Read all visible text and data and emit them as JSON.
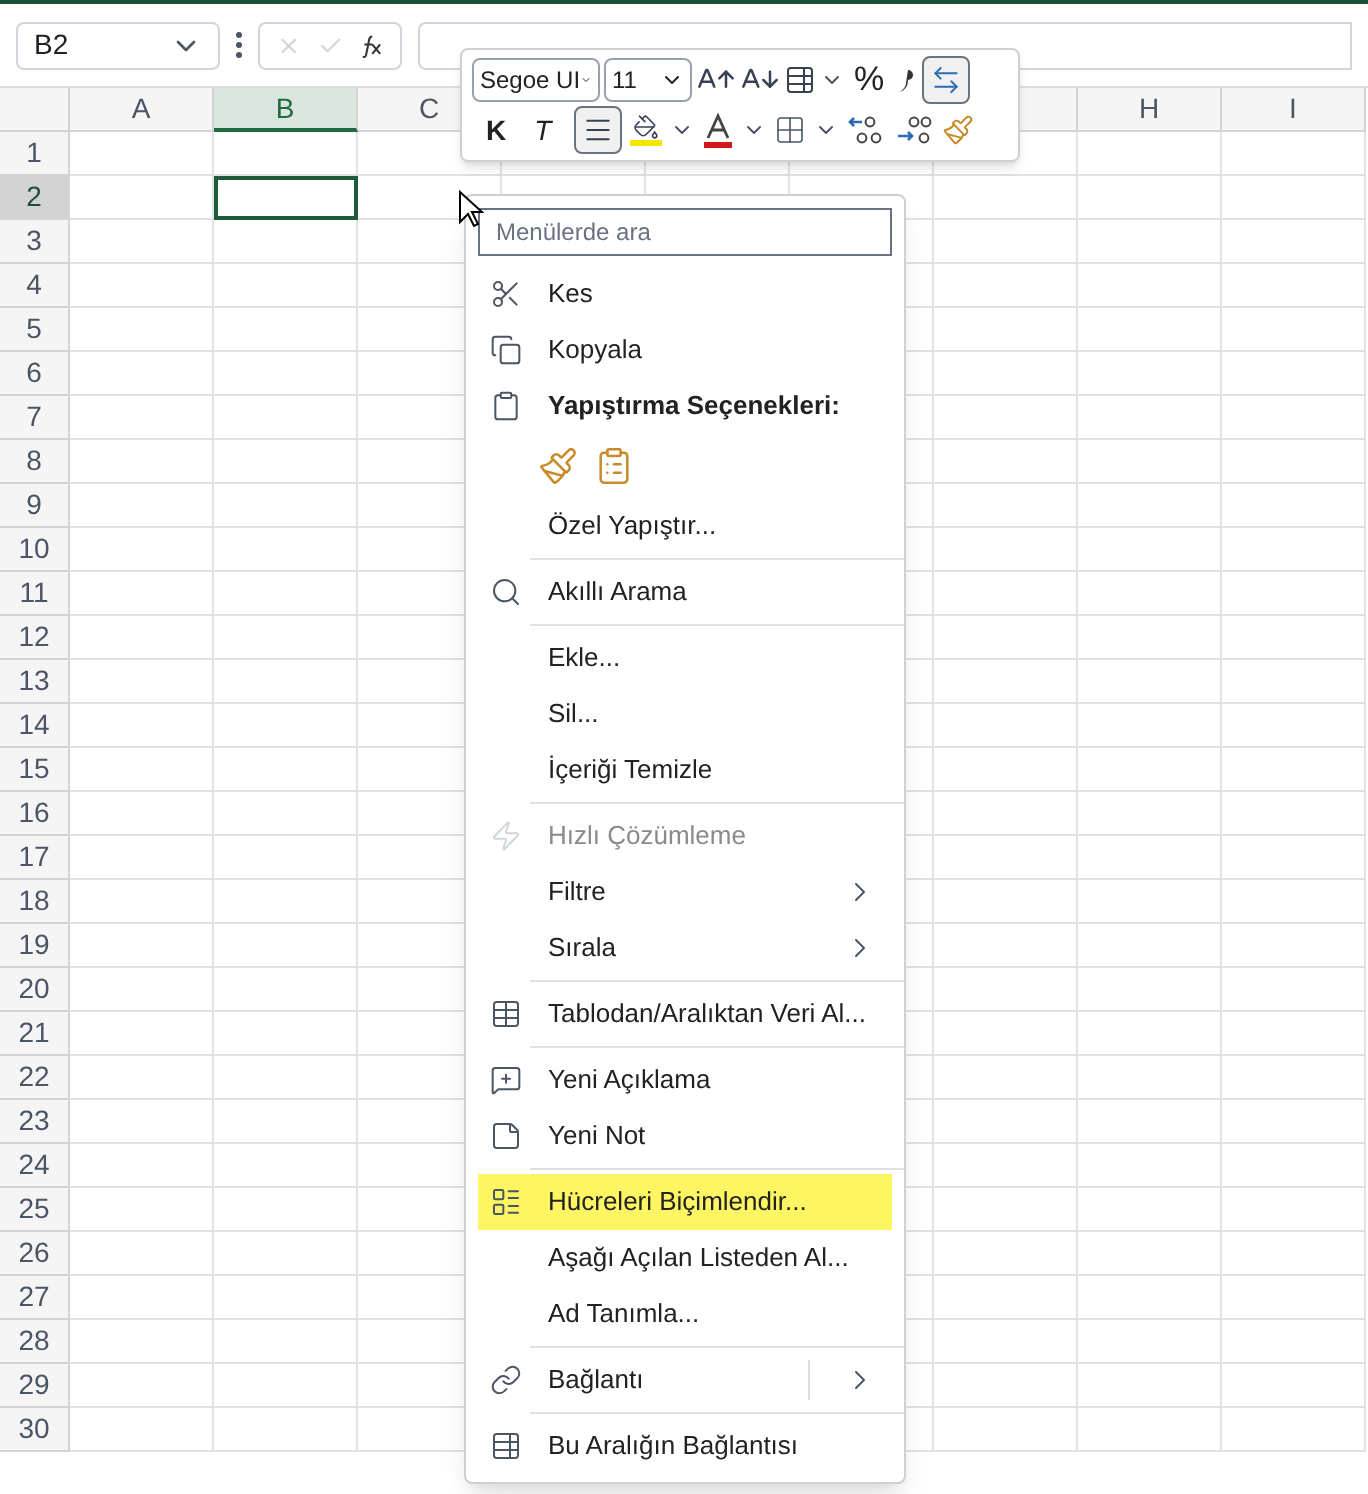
{
  "name_box": {
    "value": "B2"
  },
  "columns": [
    {
      "label": "A",
      "selected": false
    },
    {
      "label": "B",
      "selected": true
    },
    {
      "label": "C",
      "selected": false
    },
    {
      "label": "H",
      "selected": false
    },
    {
      "label": "I",
      "selected": false
    }
  ],
  "rows": [
    {
      "label": "1",
      "selected": false
    },
    {
      "label": "2",
      "selected": true
    },
    {
      "label": "3",
      "selected": false
    },
    {
      "label": "4",
      "selected": false
    },
    {
      "label": "5",
      "selected": false
    },
    {
      "label": "6",
      "selected": false
    },
    {
      "label": "7",
      "selected": false
    },
    {
      "label": "8",
      "selected": false
    },
    {
      "label": "9",
      "selected": false
    },
    {
      "label": "10",
      "selected": false
    },
    {
      "label": "11",
      "selected": false
    },
    {
      "label": "12",
      "selected": false
    },
    {
      "label": "13",
      "selected": false
    },
    {
      "label": "14",
      "selected": false
    },
    {
      "label": "15",
      "selected": false
    },
    {
      "label": "16",
      "selected": false
    },
    {
      "label": "17",
      "selected": false
    },
    {
      "label": "18",
      "selected": false
    },
    {
      "label": "19",
      "selected": false
    },
    {
      "label": "20",
      "selected": false
    },
    {
      "label": "21",
      "selected": false
    },
    {
      "label": "22",
      "selected": false
    },
    {
      "label": "23",
      "selected": false
    },
    {
      "label": "24",
      "selected": false
    },
    {
      "label": "25",
      "selected": false
    },
    {
      "label": "26",
      "selected": false
    },
    {
      "label": "27",
      "selected": false
    },
    {
      "label": "28",
      "selected": false
    },
    {
      "label": "29",
      "selected": false
    },
    {
      "label": "30",
      "selected": false
    }
  ],
  "mini_toolbar": {
    "font": "Segoe UI",
    "size": "11",
    "percent": "%",
    "bold": "K",
    "italic": "T",
    "center_selected": true,
    "wrap_selected": true
  },
  "context_menu": {
    "search_placeholder": "Menülerde ara",
    "items": [
      {
        "kind": "item",
        "label": "Kes",
        "disabled": false,
        "submenu": false,
        "highlighted": false
      },
      {
        "kind": "item",
        "label": "Kopyala",
        "disabled": false,
        "submenu": false,
        "highlighted": false
      },
      {
        "kind": "header",
        "label": "Yapıştırma Seçenekleri:"
      },
      {
        "kind": "paste"
      },
      {
        "kind": "item",
        "label": "Özel Yapıştır...",
        "disabled": false,
        "submenu": false,
        "highlighted": false
      },
      {
        "kind": "separator"
      },
      {
        "kind": "item",
        "label": "Akıllı Arama",
        "disabled": false,
        "submenu": false,
        "highlighted": false
      },
      {
        "kind": "separator"
      },
      {
        "kind": "item",
        "label": "Ekle...",
        "disabled": false,
        "submenu": false,
        "highlighted": false
      },
      {
        "kind": "item",
        "label": "Sil...",
        "disabled": false,
        "submenu": false,
        "highlighted": false
      },
      {
        "kind": "item",
        "label": "İçeriği Temizle",
        "disabled": false,
        "submenu": false,
        "highlighted": false
      },
      {
        "kind": "separator"
      },
      {
        "kind": "item",
        "label": "Hızlı Çözümleme",
        "disabled": true,
        "submenu": false,
        "highlighted": false
      },
      {
        "kind": "item",
        "label": "Filtre",
        "disabled": false,
        "submenu": true,
        "highlighted": false
      },
      {
        "kind": "item",
        "label": "Sırala",
        "disabled": false,
        "submenu": true,
        "highlighted": false
      },
      {
        "kind": "separator"
      },
      {
        "kind": "item",
        "label": "Tablodan/Aralıktan Veri Al...",
        "disabled": false,
        "submenu": false,
        "highlighted": false
      },
      {
        "kind": "separator"
      },
      {
        "kind": "item",
        "label": "Yeni Açıklama",
        "disabled": false,
        "submenu": false,
        "highlighted": false
      },
      {
        "kind": "item",
        "label": "Yeni Not",
        "disabled": false,
        "submenu": false,
        "highlighted": false
      },
      {
        "kind": "separator"
      },
      {
        "kind": "item",
        "label": "Hücreleri Biçimlendir...",
        "disabled": false,
        "submenu": false,
        "highlighted": true
      },
      {
        "kind": "item",
        "label": "Aşağı Açılan Listeden Al...",
        "disabled": false,
        "submenu": false,
        "highlighted": false
      },
      {
        "kind": "item",
        "label": "Ad Tanımla...",
        "disabled": false,
        "submenu": false,
        "highlighted": false
      },
      {
        "kind": "separator"
      },
      {
        "kind": "split",
        "label": "Bağlantı",
        "disabled": false,
        "submenu": true,
        "highlighted": false
      },
      {
        "kind": "separator"
      },
      {
        "kind": "item",
        "label": "Bu Aralığın Bağlantısı",
        "disabled": false,
        "submenu": false,
        "highlighted": false
      }
    ]
  }
}
